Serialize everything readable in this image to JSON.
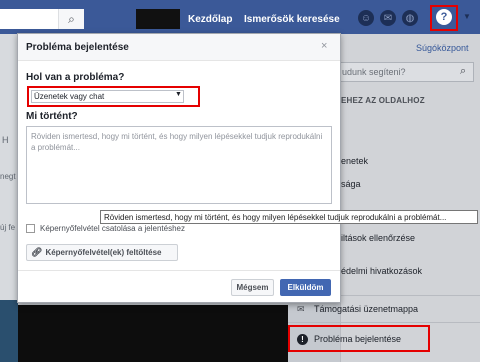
{
  "topbar": {
    "nav_home": "Kezdőlap",
    "nav_friends": "Ismerősök keresése",
    "search_icon": "search-icon",
    "friend_requests_icon": "friends-icon",
    "messages_icon": "messenger-icon",
    "notifications_icon": "globe-icon",
    "help_icon": "question-icon",
    "help_glyph": "?",
    "dropdown_glyph": "▼",
    "brand_color": "#3b5998"
  },
  "left_page": {
    "fragment_h": "H",
    "fragment_b": "negt",
    "fragment_u": "új fe"
  },
  "help_panel": {
    "help_center_link": "Súgóközpont",
    "search_placeholder": "udunk segíteni?",
    "section_heading": "EHEZ AZ OLDALHOZ",
    "items": [
      {
        "label": "enetek"
      },
      {
        "label": "sága"
      },
      {
        "label": "iltások ellenőrzése"
      },
      {
        "label": "édelmi hivatkozások"
      }
    ],
    "support_inbox": "Támogatási üzenetmappa",
    "report_problem": "Probléma bejelentése",
    "report_icon": "exclamation-icon",
    "report_glyph": "!"
  },
  "modal": {
    "title": "Probléma bejelentése",
    "close_glyph": "×",
    "question_where": "Hol van a probléma?",
    "selected_option": "Üzenetek vagy chat",
    "question_what": "Mi történt?",
    "textarea_placeholder": "Röviden ismertesd, hogy mi történt, és hogy milyen lépésekkel tudjuk reprodukálni a problémát...",
    "checkbox_label": "Képernyőfelvétel csatolása a jelentéshez",
    "upload_button": "Képernyőfelvétel(ek) feltöltése",
    "cancel_button": "Mégsem",
    "send_button": "Elküldöm",
    "send_color": "#4267b2",
    "highlight_color": "#e50000"
  },
  "tooltip": {
    "text": "Röviden ismertesd, hogy mi történt, és hogy milyen lépésekkel tudjuk reprodukálni a problémát..."
  }
}
